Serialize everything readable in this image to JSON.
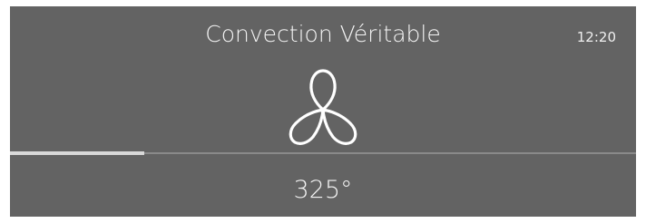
{
  "mode": {
    "title": "Convection Véritable"
  },
  "status": {
    "time": "12:20"
  },
  "fan": {
    "icon": "fan-icon"
  },
  "progress": {
    "fraction": 0.215
  },
  "temperature": {
    "value": "325°"
  },
  "colors": {
    "background": "#636363",
    "text": "#f4f4f4",
    "progress_fill": "#d9d9d9",
    "progress_track": "#8a8a8a"
  }
}
